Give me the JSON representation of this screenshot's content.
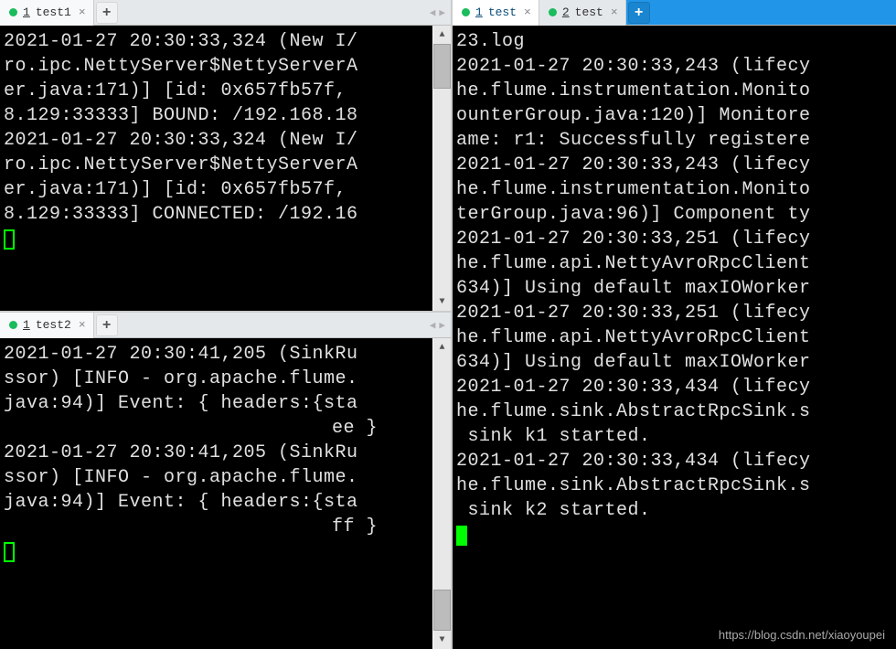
{
  "panes": {
    "topLeft": {
      "tab": {
        "num": "1",
        "label": "test1"
      },
      "lines": [
        "2021-01-27 20:30:33,324 (New I/",
        "ro.ipc.NettyServer$NettyServerA",
        "er.java:171)] [id: 0x657fb57f,",
        "8.129:33333] BOUND: /192.168.18",
        "2021-01-27 20:30:33,324 (New I/",
        "ro.ipc.NettyServer$NettyServerA",
        "er.java:171)] [id: 0x657fb57f,",
        "8.129:33333] CONNECTED: /192.16"
      ],
      "scrollThumb": {
        "top": "0%",
        "height": "18%"
      }
    },
    "bottomLeft": {
      "tab": {
        "num": "1",
        "label": "test2"
      },
      "lines": [
        "2021-01-27 20:30:41,205 (SinkRu",
        "ssor) [INFO - org.apache.flume.",
        "java:94)] Event: { headers:{sta",
        {
          "text": "ee }",
          "align": "right"
        },
        "2021-01-27 20:30:41,205 (SinkRu",
        "ssor) [INFO - org.apache.flume.",
        "java:94)] Event: { headers:{sta",
        {
          "text": "ff }",
          "align": "right"
        }
      ],
      "scrollThumb": {
        "top": "85%",
        "height": "15%"
      }
    },
    "right": {
      "tabs": [
        {
          "num": "1",
          "label": "test",
          "active": true
        },
        {
          "num": "2",
          "label": "test",
          "active": false
        }
      ],
      "lines": [
        "23.log",
        "2021-01-27 20:30:33,243 (lifecy",
        "he.flume.instrumentation.Monito",
        "ounterGroup.java:120)] Monitore",
        "ame: r1: Successfully registere",
        "2021-01-27 20:30:33,243 (lifecy",
        "he.flume.instrumentation.Monito",
        "terGroup.java:96)] Component ty",
        "2021-01-27 20:30:33,251 (lifecy",
        "he.flume.api.NettyAvroRpcClient",
        "634)] Using default maxIOWorker",
        "2021-01-27 20:30:33,251 (lifecy",
        "he.flume.api.NettyAvroRpcClient",
        "634)] Using default maxIOWorker",
        "2021-01-27 20:30:33,434 (lifecy",
        "he.flume.sink.AbstractRpcSink.s",
        " sink k1 started.",
        "2021-01-27 20:30:33,434 (lifecy",
        "he.flume.sink.AbstractRpcSink.s",
        " sink k2 started."
      ]
    }
  },
  "watermark": "https://blog.csdn.net/xiaoyoupei"
}
